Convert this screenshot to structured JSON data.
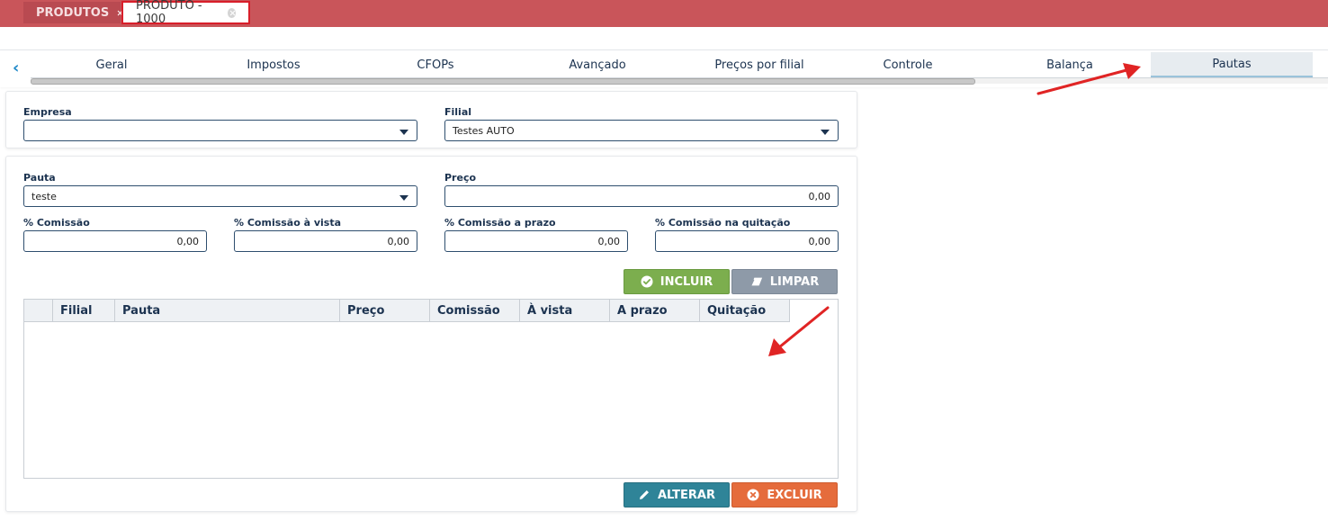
{
  "doc_tabs": [
    {
      "label": "PRODUTOS"
    },
    {
      "label": "PRODUTO - 1000"
    }
  ],
  "sub_tabs": [
    {
      "label": "Geral"
    },
    {
      "label": "Impostos"
    },
    {
      "label": "CFOPs"
    },
    {
      "label": "Avançado"
    },
    {
      "label": "Preços por filial"
    },
    {
      "label": "Controle"
    },
    {
      "label": "Balança"
    },
    {
      "label": "Pautas"
    }
  ],
  "filters": {
    "empresa_label": "Empresa",
    "empresa_value": "",
    "filial_label": "Filial",
    "filial_value": "Testes AUTO"
  },
  "form": {
    "pauta_label": "Pauta",
    "pauta_value": "teste",
    "preco_label": "Preço",
    "preco_value": "0,00",
    "comissao_label": "% Comissão",
    "comissao_value": "0,00",
    "comissao_vista_label": "% Comissão à vista",
    "comissao_vista_value": "0,00",
    "comissao_prazo_label": "% Comissão a prazo",
    "comissao_prazo_value": "0,00",
    "comissao_quitacao_label": "% Comissão na quitação",
    "comissao_quitacao_value": "0,00"
  },
  "buttons": {
    "incluir": "INCLUIR",
    "limpar": "LIMPAR",
    "alterar": "ALTERAR",
    "excluir": "EXCLUIR"
  },
  "table": {
    "columns": [
      "Filial",
      "Pauta",
      "Preço",
      "Comissão",
      "À vista",
      "A prazo",
      "Quitação"
    ],
    "rows": []
  },
  "icons": {
    "nav_prev": "chevron-left-icon",
    "tab_close": "close-circle-icon",
    "incluir": "check-circle-icon",
    "limpar": "eraser-icon",
    "alterar": "pencil-icon",
    "excluir": "close-circle-icon"
  },
  "colors": {
    "topbar": "#c9555a",
    "active_tab_border": "#d81e2a",
    "incluir": "#7cae4e",
    "limpar": "#8e9aa8",
    "alterar": "#2f8498",
    "excluir": "#e56c3c",
    "annotation_arrow": "#e02424"
  }
}
